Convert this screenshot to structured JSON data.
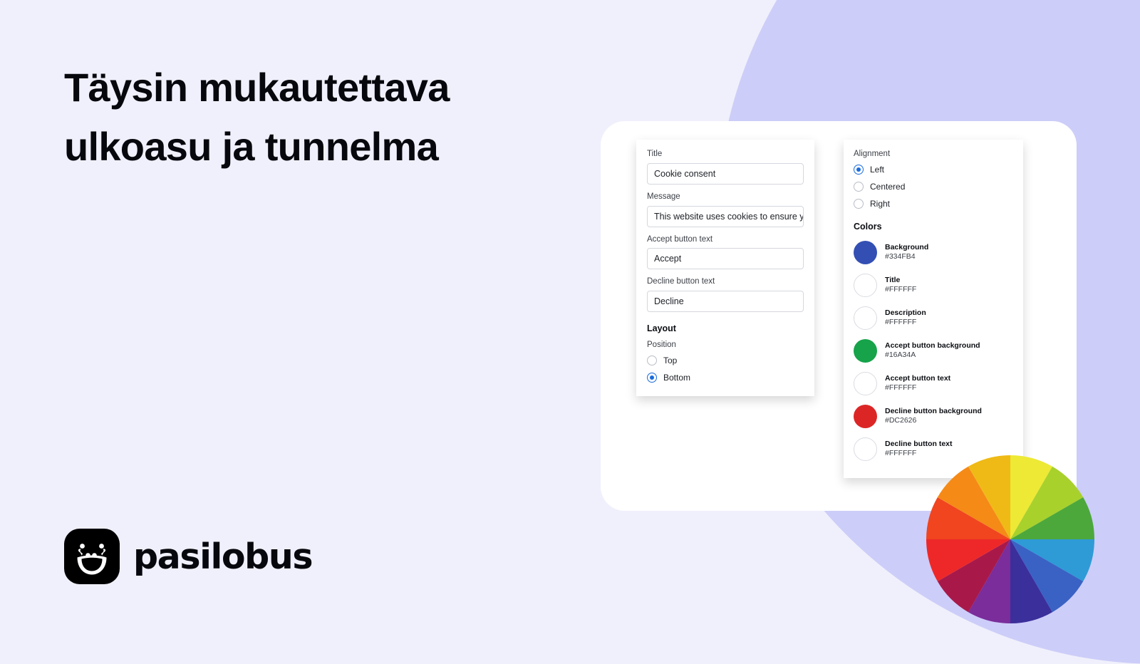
{
  "hero": {
    "headline_lines": [
      "Täysin mukautettava",
      "ulkoasu ja tunnelma"
    ],
    "logo_word": "pasilobus",
    "logo_icon": "smiley-face-icon"
  },
  "colors": {
    "page_background": "#F0F0FC",
    "decorative_blob": "#CDCDF9",
    "card_background": "#FFFFFF",
    "accent_radio": "#1A6BDB",
    "heading_text": "#07080D"
  },
  "content_panel": {
    "fields": [
      {
        "label": "Title",
        "value": "Cookie consent"
      },
      {
        "label": "Message",
        "value": "This website uses cookies to ensure y"
      },
      {
        "label": "Accept button text",
        "value": "Accept"
      },
      {
        "label": "Decline button text",
        "value": "Decline"
      }
    ],
    "layout_heading": "Layout",
    "position_label": "Position",
    "position_options": [
      {
        "label": "Top",
        "selected": false
      },
      {
        "label": "Bottom",
        "selected": true
      }
    ]
  },
  "appearance_panel": {
    "alignment_label": "Alignment",
    "alignment_options": [
      {
        "label": "Left",
        "selected": true
      },
      {
        "label": "Centered",
        "selected": false
      },
      {
        "label": "Right",
        "selected": false
      }
    ],
    "colors_heading": "Colors",
    "color_items": [
      {
        "name": "Background",
        "hex": "#334FB4",
        "swatch": "#334FB4"
      },
      {
        "name": "Title",
        "hex": "#FFFFFF",
        "swatch": "#FFFFFF"
      },
      {
        "name": "Description",
        "hex": "#FFFFFF",
        "swatch": "#FFFFFF"
      },
      {
        "name": "Accept button background",
        "hex": "#16A34A",
        "swatch": "#16A34A"
      },
      {
        "name": "Accept button text",
        "hex": "#FFFFFF",
        "swatch": "#FFFFFF"
      },
      {
        "name": "Decline button background",
        "hex": "#DC2626",
        "swatch": "#DC2626"
      },
      {
        "name": "Decline button text",
        "hex": "#FFFFFF",
        "swatch": "#FFFFFF"
      }
    ]
  },
  "color_wheel": {
    "segments": [
      "#EDE935",
      "#A8D12C",
      "#4CA83B",
      "#2E9BD6",
      "#3A62C4",
      "#3B2F9B",
      "#5B2D9B",
      "#8B2F9B",
      "#A8194A",
      "#EE2828",
      "#F0451F",
      "#F58A17",
      "#F0A517",
      "#EFC716"
    ],
    "segment_colors_12": [
      "#EDE935",
      "#A8D12C",
      "#4CA83B",
      "#2E9BD6",
      "#3A62C4",
      "#3B2F9B",
      "#7A2D9B",
      "#A8194A",
      "#EE2828",
      "#F0451F",
      "#F58A17",
      "#EFBA16"
    ]
  }
}
